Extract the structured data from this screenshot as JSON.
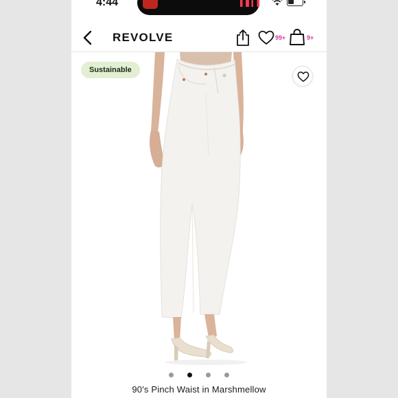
{
  "status_bar": {
    "time": "4:44",
    "icons": [
      "recording-app-icon",
      "audio-wave-icon",
      "wifi-icon",
      "battery-icon"
    ]
  },
  "nav": {
    "brand": "REVOLVE",
    "favorites_badge": "99+",
    "bag_badge": "9+",
    "icons": [
      "back-chevron-icon",
      "share-icon",
      "heart-icon",
      "shopping-bag-icon"
    ]
  },
  "product": {
    "tag": "Sustainable",
    "title": "90's Pinch Waist in Marshmellow",
    "image_count": 4,
    "active_image": 2,
    "icons": [
      "heart-outline-icon"
    ]
  },
  "colors": {
    "tag_bg": "#e3efd2",
    "badge": "#d63ca4",
    "jeans": "#f4f2ef",
    "skin": "#d9b39a"
  }
}
